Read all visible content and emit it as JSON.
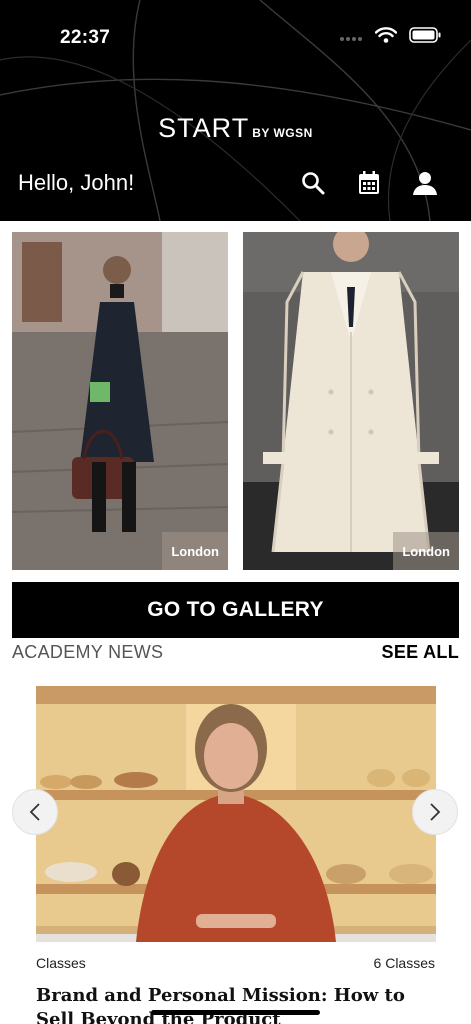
{
  "status_bar": {
    "time": "22:37"
  },
  "header": {
    "brand_main": "START",
    "brand_by": "BY WGSN",
    "greeting": "Hello, John!",
    "icons": [
      "search-icon",
      "calendar-icon",
      "profile-icon"
    ]
  },
  "gallery": {
    "photos": [
      {
        "location": "London"
      },
      {
        "location": "London"
      }
    ],
    "button_label": "GO TO GALLERY"
  },
  "academy": {
    "section_title": "ACADEMY NEWS",
    "see_all": "SEE ALL",
    "card": {
      "category": "Classes",
      "count": "6 Classes",
      "title": "Brand and Personal Mission: How to Sell Beyond the Product"
    }
  },
  "colors": {
    "header_bg": "#000000",
    "button_bg": "#000000",
    "accent_text": "#ffffff"
  }
}
